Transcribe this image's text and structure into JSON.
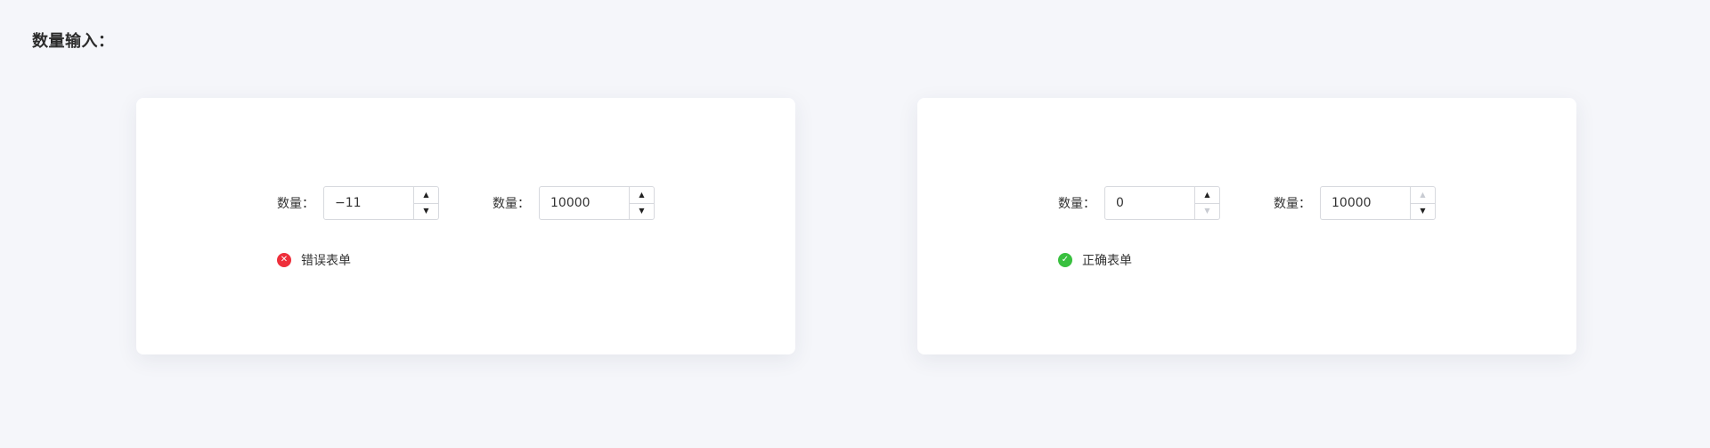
{
  "page": {
    "title": "数量输入："
  },
  "cards": [
    {
      "fields": [
        {
          "label": "数量：",
          "value": "−11",
          "up_disabled": false,
          "down_disabled": false
        },
        {
          "label": "数量：",
          "value": "10000",
          "up_disabled": false,
          "down_disabled": false
        }
      ],
      "status": {
        "type": "error",
        "icon": "close-icon",
        "text": "错误表单",
        "color": "#ee2f3b"
      }
    },
    {
      "fields": [
        {
          "label": "数量：",
          "value": "0",
          "up_disabled": false,
          "down_disabled": true
        },
        {
          "label": "数量：",
          "value": "10000",
          "up_disabled": true,
          "down_disabled": false
        }
      ],
      "status": {
        "type": "success",
        "icon": "check-icon",
        "text": "正确表单",
        "color": "#39c03f"
      }
    }
  ]
}
